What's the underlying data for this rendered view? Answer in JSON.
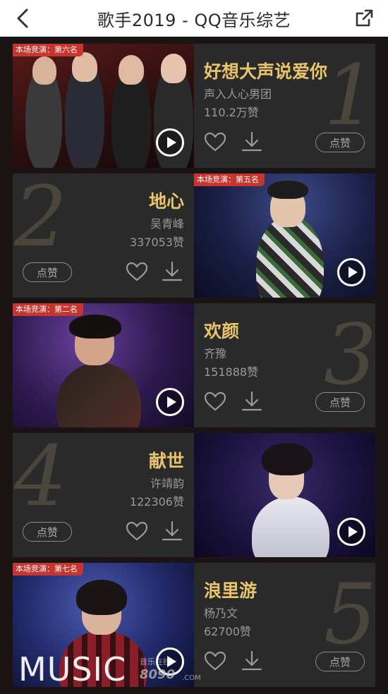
{
  "header": {
    "title": "歌手2019 - QQ音乐综艺"
  },
  "items": [
    {
      "rank": "1",
      "badge": "本场竞演：第六名",
      "song": "好想大声说爱你",
      "singer": "声入人心男团",
      "likes": "110.2万赞",
      "like_label": "点赞"
    },
    {
      "rank": "2",
      "badge": "本场竞演：第五名",
      "song": "地心",
      "singer": "吴青峰",
      "likes": "337053赞",
      "like_label": "点赞"
    },
    {
      "rank": "3",
      "badge": "本场竞演：第二名",
      "song": "欢颜",
      "singer": "齐豫",
      "likes": "151888赞",
      "like_label": "点赞"
    },
    {
      "rank": "4",
      "badge": "",
      "song": "献世",
      "singer": "许靖韵",
      "likes": "122306赞",
      "like_label": "点赞"
    },
    {
      "rank": "5",
      "badge": "本场竞演：第七名",
      "song": "浪里游",
      "singer": "杨乃文",
      "likes": "62700赞",
      "like_label": "点赞"
    }
  ],
  "watermark": {
    "text": "MUSIC",
    "site_cn": "音乐在线",
    "site_num": "8090",
    "site_com": ".COM"
  },
  "colors": {
    "song": "#e9c46b",
    "badge": "#c8352f",
    "background": "#1b1414",
    "card": "#2a2a2a"
  },
  "icons": {
    "back": "chevron-left-icon",
    "share": "share-icon",
    "play": "play-icon",
    "heart": "heart-icon",
    "download": "download-icon"
  }
}
